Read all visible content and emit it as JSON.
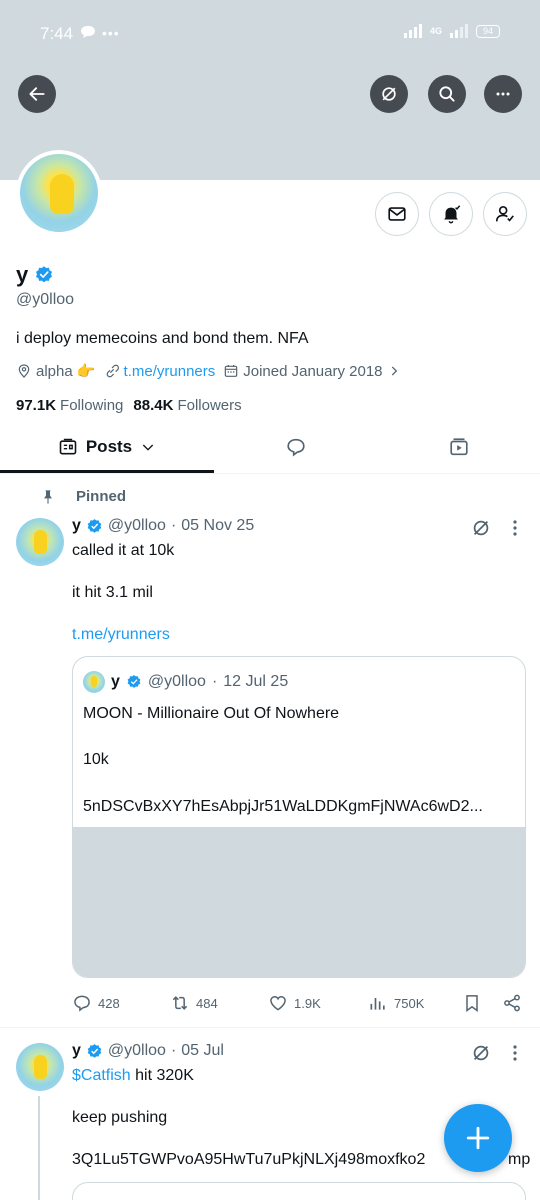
{
  "status_bar": {
    "time": "7:44",
    "battery": "94",
    "network": "4G"
  },
  "profile": {
    "name": "y",
    "handle": "@y0lloo",
    "bio": "i deploy memecoins and bond them. NFA",
    "location": "alpha 👉",
    "link": "t.me/yrunners",
    "joined": "Joined January 2018",
    "following_count": "97.1K",
    "following_label": "Following",
    "followers_count": "88.4K",
    "followers_label": "Followers"
  },
  "tabs": {
    "posts_label": "Posts"
  },
  "pinned_label": "Pinned",
  "post1": {
    "name": "y",
    "handle": "@y0lloo",
    "sep": "·",
    "date": "05 Nov 25",
    "line1": "called it at 10k",
    "line2": "it hit 3.1 mil",
    "link": "t.me/yrunners",
    "quote": {
      "name": "y",
      "handle": "@y0lloo",
      "sep": "·",
      "date": "12 Jul 25",
      "line1": "MOON - Millionaire Out Of Nowhere",
      "line2": "10k",
      "line3": "5nDSCvBxXY7hEsAbpjJr51WaLDDKgmFjNWAc6wD2..."
    },
    "stats": {
      "replies": "428",
      "reposts": "484",
      "likes": "1.9K",
      "views": "750K"
    }
  },
  "post2": {
    "name": "y",
    "handle": "@y0lloo",
    "sep": "·",
    "date": "05 Jul",
    "cashtag": "$Catfish",
    "line1_rest": " hit 320K",
    "line2": "keep pushing",
    "line3": "3Q1Lu5TGWPvoA95HwTu7uPkjNLXj498moxfko2",
    "line3_tail": "mp"
  },
  "colors": {
    "accent": "#1d9bf0",
    "banner": "#cfd9de",
    "text_secondary": "#536471"
  }
}
